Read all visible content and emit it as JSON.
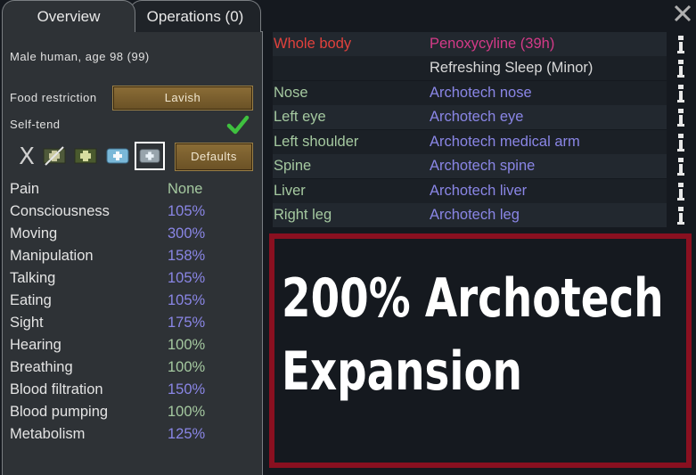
{
  "tabs": [
    {
      "label": "Overview",
      "active": true
    },
    {
      "label": "Operations (0)",
      "active": false
    }
  ],
  "pawn": {
    "description": "Male human, age 98 (99)"
  },
  "food_restriction": {
    "label": "Food restriction",
    "value": "Lavish"
  },
  "self_tend": {
    "label": "Self-tend",
    "checked": true
  },
  "toolbar": {
    "defaults_label": "Defaults",
    "x_label": "X"
  },
  "capacities": [
    {
      "label": "Pain",
      "value": "None"
    },
    {
      "label": "Consciousness",
      "value": "105%"
    },
    {
      "label": "Moving",
      "value": "300%"
    },
    {
      "label": "Manipulation",
      "value": "158%"
    },
    {
      "label": "Talking",
      "value": "105%"
    },
    {
      "label": "Eating",
      "value": "105%"
    },
    {
      "label": "Sight",
      "value": "175%"
    },
    {
      "label": "Hearing",
      "value": "100%"
    },
    {
      "label": "Breathing",
      "value": "100%"
    },
    {
      "label": "Blood filtration",
      "value": "150%"
    },
    {
      "label": "Blood pumping",
      "value": "100%"
    },
    {
      "label": "Metabolism",
      "value": "125%"
    }
  ],
  "hediffs": [
    {
      "part": "Whole body",
      "condition": "Penoxycyline (39h)"
    },
    {
      "part": "",
      "condition": "Refreshing Sleep (Minor)"
    },
    {
      "part": "Nose",
      "condition": "Archotech nose"
    },
    {
      "part": "Left eye",
      "condition": "Archotech eye"
    },
    {
      "part": "Left shoulder",
      "condition": "Archotech medical arm"
    },
    {
      "part": "Spine",
      "condition": "Archotech spine"
    },
    {
      "part": "Liver",
      "condition": "Archotech liver"
    },
    {
      "part": "Right leg",
      "condition": "Archotech leg"
    }
  ],
  "banner": {
    "line1": "200% Archotech",
    "line2": "Expansion"
  },
  "colors": {
    "capacity_green": "#a5c9a0",
    "capacity_blue": "#8a86e6",
    "whole_body_red": "#e0413c",
    "drug_pink": "#d43a88",
    "banner_border": "#8a1020"
  },
  "icons": [
    "close-icon",
    "check-icon",
    "info-icon",
    "medicine-icon"
  ]
}
